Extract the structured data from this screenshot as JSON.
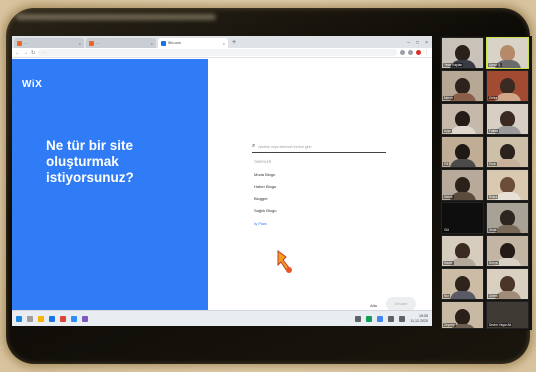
{
  "browser": {
    "tabs": [
      {
        "title": "…",
        "active": false
      },
      {
        "title": "…",
        "active": false
      },
      {
        "title": "Wix.com",
        "active": true
      }
    ],
    "url": "…"
  },
  "page": {
    "brand_logo": "WiX",
    "hero_question": "Ne tür bir site oluşturmak istiyorsunuz?",
    "search_placeholder": "İşletme veya sitenizin türünü girin",
    "suggestions_header": "ÖNERİLER",
    "suggestions": [
      "Moda Blogu",
      "Haber Blogu",
      "Blogger",
      "Sağlık Blogu"
    ],
    "more_link": "İş Planı",
    "skip_label": "Atla",
    "next_button": "Devam"
  },
  "taskbar": {
    "time": "19:05",
    "date": "11.12.2020"
  },
  "gallery": {
    "participants": [
      "Yeter Kaplan",
      "Aynur Ş.",
      "Merve",
      "Zehra",
      "Ayşe",
      "Fatma",
      "Elif",
      "Esra",
      "Melek",
      "Büşra",
      "Gül",
      "Seda",
      "Hacer",
      "Derya",
      "Nur",
      "Ceren",
      "Sevgi",
      "Emine",
      "Zeynep",
      "Sevim Yaşar Ak"
    ]
  },
  "colors": {
    "wix_blue": "#2f7cf6",
    "frame": "#0c0a06",
    "active_speaker": "#c7e14a"
  }
}
